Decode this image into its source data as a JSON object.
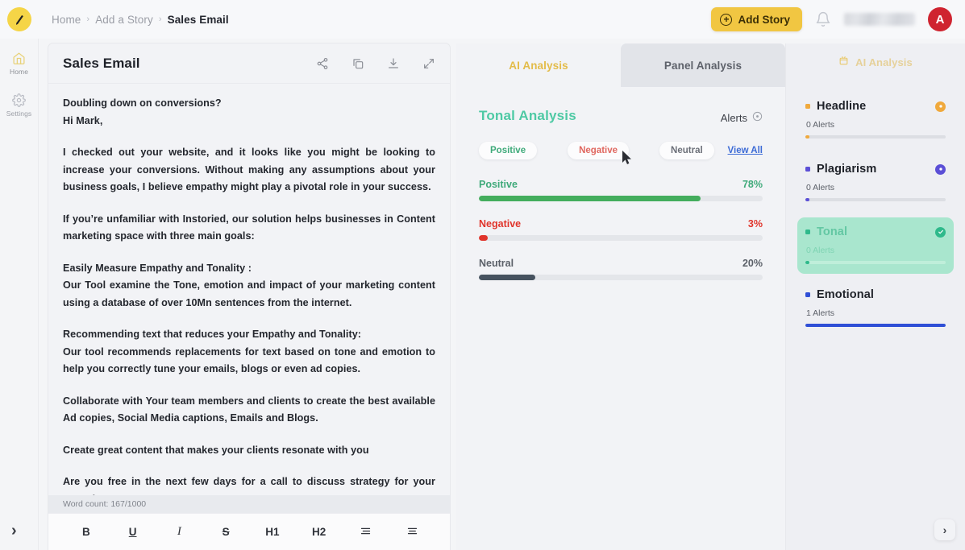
{
  "topbar": {
    "logo_icon": "pen-logo-icon",
    "breadcrumb": [
      {
        "label": "Home",
        "current": false
      },
      {
        "label": "Add a Story",
        "current": false
      },
      {
        "label": "Sales Email",
        "current": true
      }
    ],
    "separator": "›",
    "add_story_label": "Add Story",
    "plus_glyph": "+",
    "bell_icon": "notification-bell-icon",
    "avatar_initial": "A",
    "avatar_color": "#cf2430",
    "accent_color": "#f1c642"
  },
  "sidebar": {
    "items": [
      {
        "label": "Home",
        "icon": "home-icon",
        "active": true
      },
      {
        "label": "Settings",
        "icon": "gear-icon",
        "active": false
      }
    ],
    "expand_glyph": "›"
  },
  "editor": {
    "title": "Sales Email",
    "icons": [
      "share-icon",
      "copy-icon",
      "download-icon",
      "expand-icon"
    ],
    "paragraphs": [
      {
        "text": "Doubling down on conversions?",
        "gap": "none"
      },
      {
        "text": "Hi Mark,",
        "gap": "none"
      },
      {
        "text": "I checked out your website, and it looks like you might be looking to increase your conversions. Without making any assumptions about your business goals, I believe empathy might play a pivotal role in your success.",
        "gap": "large"
      },
      {
        "text": "If you’re unfamiliar with Instoried, our solution helps businesses in Content marketing space with three main goals:",
        "gap": "large"
      },
      {
        "text": "Easily Measure Empathy and Tonality :",
        "gap": "large"
      },
      {
        "text": "Our Tool examine the Tone, emotion and impact of your marketing content using a database of over 10Mn sentences from the internet.",
        "gap": "none"
      },
      {
        "text": "Recommending text that reduces your Empathy and Tonality:",
        "gap": "large"
      },
      {
        "text": "Our tool recommends replacements for text based on tone and emotion to help you correctly tune your emails, blogs or even ad copies.",
        "gap": "none"
      },
      {
        "text": "Collaborate with Your team members and clients to create the best available Ad copies, Social Media captions, Emails and Blogs.",
        "gap": "large"
      },
      {
        "text": "Create great content that makes your clients resonate with you",
        "gap": "large"
      },
      {
        "text": "Are you free in the next few days for a call to discuss strategy for your Growth?",
        "gap": "large"
      }
    ],
    "word_count": "Word count: 167/1000",
    "toolbar": [
      {
        "label": "B",
        "name": "bold-button",
        "style": "bd"
      },
      {
        "label": "U",
        "name": "underline-button",
        "style": "un"
      },
      {
        "label": "I",
        "name": "italic-button",
        "style": "it"
      },
      {
        "label": "S",
        "name": "strikethrough-button",
        "style": "st"
      },
      {
        "label": "H1",
        "name": "heading1-button",
        "style": "bd"
      },
      {
        "label": "H2",
        "name": "heading2-button",
        "style": "bd"
      },
      {
        "label": "",
        "name": "align-list-button",
        "style": "icon"
      },
      {
        "label": "",
        "name": "align-center-button",
        "style": "icon"
      }
    ]
  },
  "middle": {
    "tabs": [
      {
        "label": "AI Analysis",
        "active": true
      },
      {
        "label": "Panel Analysis",
        "active": false
      }
    ],
    "tonal_title": "Tonal Analysis",
    "tonal_title_color": "#4ec9a4",
    "alerts_label": "Alerts",
    "alerts_info_icon": "info-circle-icon",
    "chips": [
      {
        "label": "Positive",
        "tone": "pos"
      },
      {
        "label": "Negative",
        "tone": "neg"
      },
      {
        "label": "Neutral",
        "tone": "neu"
      }
    ],
    "view_all_label": "View All",
    "cursor_icon": "mouse-pointer-icon"
  },
  "chart_data": {
    "type": "bar",
    "title": "Tonal Analysis",
    "orientation": "horizontal",
    "categories": [
      "Positive",
      "Negative",
      "Neutral"
    ],
    "values": [
      78,
      3,
      20
    ],
    "value_labels": [
      "78%",
      "3%",
      "20%"
    ],
    "colors": [
      "#44ad5d",
      "#e0342b",
      "#46525f"
    ],
    "track_color": "#e4e6ea",
    "xlabel": "",
    "ylabel": "",
    "xlim": [
      0,
      100
    ],
    "grid": false,
    "legend": "none"
  },
  "right_panel": {
    "header": "AI Analysis",
    "header_icon": "ai-analysis-icon",
    "cards": [
      {
        "name": "Headline",
        "alerts": "0 Alerts",
        "color": "#f0a93c",
        "fill_pct": 2,
        "selected": false,
        "badge_icon": "dot-circle-icon"
      },
      {
        "name": "Plagiarism",
        "alerts": "0 Alerts",
        "color": "#5b4fd6",
        "fill_pct": 2,
        "selected": false,
        "badge_icon": "dot-circle-icon"
      },
      {
        "name": "Tonal",
        "alerts": "0 Alerts",
        "color": "#2fb98b",
        "fill_pct": 2,
        "selected": true,
        "badge_icon": "check-circle-icon"
      },
      {
        "name": "Emotional",
        "alerts": "1 Alerts",
        "color": "#2f4fd6",
        "fill_pct": 100,
        "selected": false,
        "badge_icon": "none"
      }
    ],
    "expand_glyph": "›"
  }
}
